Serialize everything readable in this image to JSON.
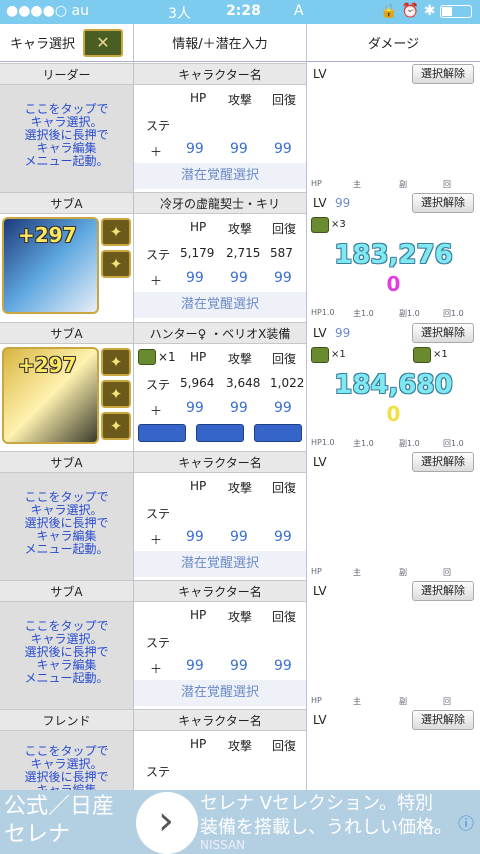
{
  "status": {
    "carrier": "●●●●○ au",
    "tab": "3人",
    "time": "2:28",
    "letter": "A",
    "icons": "🔒 ⏰ ✱"
  },
  "header": {
    "char_select": "キャラ選択",
    "info": "情報/＋潜在入力",
    "damage": "ダメージ"
  },
  "slot_headers": {
    "hp": "HP",
    "atk": "攻撃",
    "rcv": "回復",
    "stats": "ステ",
    "plus": "＋",
    "plus_val": "99",
    "latent": "潜在覚醒選択",
    "lv": "LV",
    "release": "選択解除",
    "axis": [
      "HP",
      "主",
      "副",
      "回"
    ]
  },
  "tap_hint": [
    "ここをタップで",
    "キャラ選択。",
    "選択後に長押で",
    "キャラ編集",
    "メニュー起動。"
  ],
  "slots": [
    {
      "role": "リーダー",
      "name": "キャラクター名",
      "empty": true
    },
    {
      "role": "サブA",
      "name": "冷牙の虚龍契士・キリ",
      "plus_badge": "+297",
      "hp": "5,179",
      "atk": "2,715",
      "rcv": "587",
      "lv": "99",
      "mult": "×3",
      "damage": "183,276",
      "sub": "0",
      "axis": [
        "HP1.0",
        "主1.0",
        "副1.0",
        "回1.0"
      ]
    },
    {
      "role": "サブA",
      "name": "ハンター♀ ・ベリオX装備",
      "plus_badge": "+297",
      "hp": "5,964",
      "atk": "3,648",
      "rcv": "1,022",
      "lv": "99",
      "mult_l": "×1",
      "mult_r": "×1",
      "row_mult": "×1",
      "damage": "184,680",
      "sub": "0",
      "axis": [
        "HP1.0",
        "主1.0",
        "副1.0",
        "回1.0"
      ]
    },
    {
      "role": "サブA",
      "name": "キャラクター名",
      "empty": true
    },
    {
      "role": "サブA",
      "name": "キャラクター名",
      "empty": true
    },
    {
      "role": "フレンド",
      "name": "キャラクター名",
      "empty": true
    }
  ],
  "colors": {
    "status": "#7ecbf0",
    "latent_text": "#6b8ac8",
    "damage": "#7fe8f0",
    "sub1": "#e040e0",
    "sub2": "#f0e040"
  },
  "ad": {
    "left1": "公式／日産",
    "left2": "セレナ",
    "right1": "セレナ Vセレクション。特別",
    "right2": "装備を搭載し、うれしい価格。",
    "brand": "NISSAN",
    "arrow": "›",
    "info": "ⓘ"
  }
}
